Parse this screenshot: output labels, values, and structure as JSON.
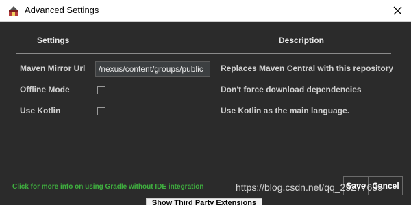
{
  "window": {
    "title": "Advanced Settings"
  },
  "table": {
    "header_settings": "Settings",
    "header_description": "Description"
  },
  "rows": [
    {
      "label": "Maven Mirror Url",
      "control": "text",
      "value": "/nexus/content/groups/public",
      "description": "Replaces Maven Central with this repository"
    },
    {
      "label": "Offline Mode",
      "control": "checkbox",
      "checked": false,
      "description": "Don't force download dependencies"
    },
    {
      "label": "Use Kotlin",
      "control": "checkbox",
      "checked": false,
      "description": "Use Kotlin as the main language."
    }
  ],
  "footer": {
    "info_link": "Click for more info on using Gradle without IDE integration",
    "save_label": "Save",
    "cancel_label": "Cancel"
  },
  "background": {
    "button_label": "Show Third Party Extensions"
  },
  "watermark": "https://blog.csdn.net/qq_25277639",
  "colors": {
    "dialog_bg": "#2b2b2b",
    "titlebar_bg": "#ffffff",
    "text": "#cfcfcf",
    "link": "#3fb03f"
  },
  "icons": {
    "app": "app-icon",
    "close": "close-icon"
  }
}
